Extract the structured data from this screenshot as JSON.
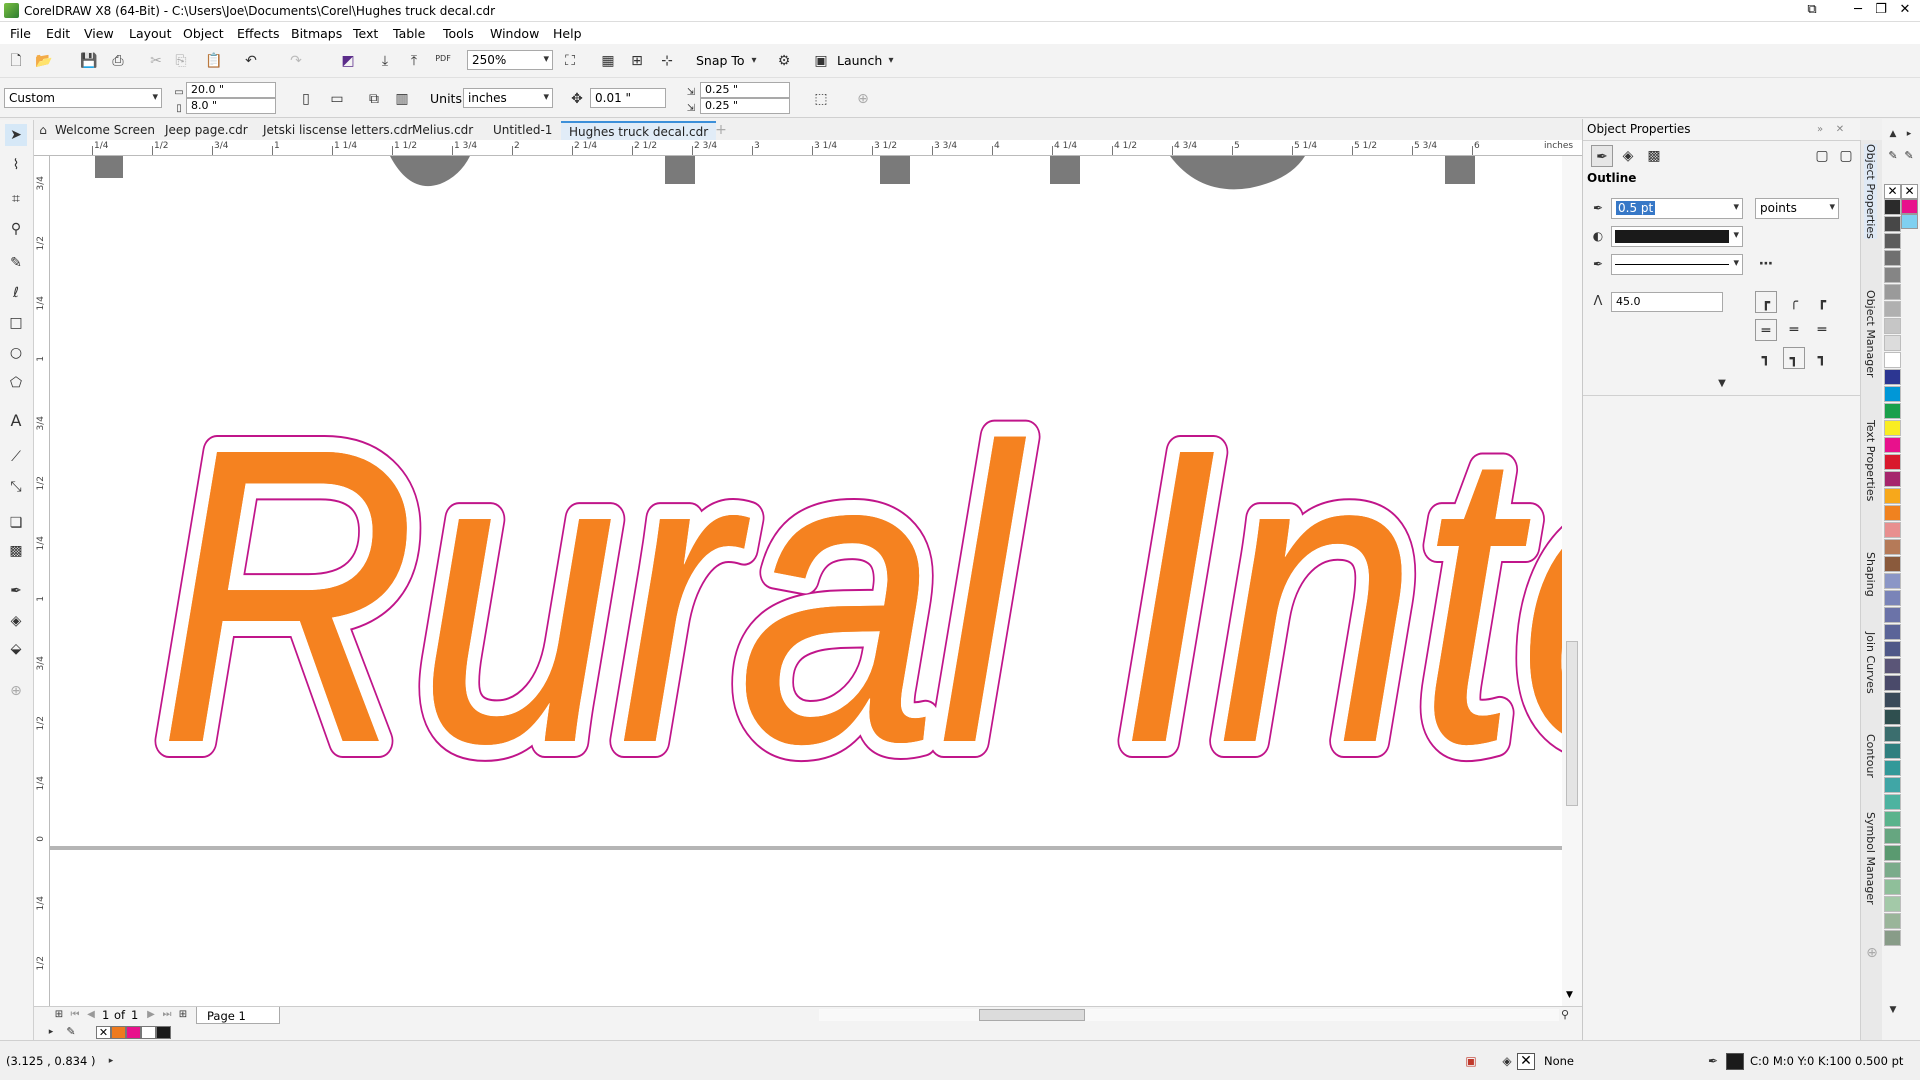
{
  "window": {
    "title": "CorelDRAW X8 (64-Bit) - C:\\Users\\Joe\\Documents\\Corel\\Hughes truck decal.cdr"
  },
  "menu": [
    "File",
    "Edit",
    "View",
    "Layout",
    "Object",
    "Effects",
    "Bitmaps",
    "Text",
    "Table",
    "Tools",
    "Window",
    "Help"
  ],
  "toolbar": {
    "pdf_label": "PDF",
    "zoom": "250%",
    "snap_label": "Snap To",
    "launch_label": "Launch"
  },
  "propertybar": {
    "page_size": "Custom",
    "width": "20.0 \"",
    "height": "8.0 \"",
    "units_label": "Units:",
    "units": "inches",
    "nudge": "0.01 \"",
    "dup_x": "0.25 \"",
    "dup_y": "0.25 \""
  },
  "tabs": [
    "Welcome Screen",
    "Jeep page.cdr",
    "Jetski liscense letters.cdr",
    "Melius.cdr",
    "Untitled-1",
    "Hughes truck decal.cdr"
  ],
  "active_tab": "Hughes truck decal.cdr",
  "ruler": {
    "h_labels": [
      "1/4",
      "1/2",
      "3/4",
      "1",
      "1 1/4",
      "1 1/2",
      "1 3/4",
      "2",
      "2 1/4",
      "2 1/2",
      "2 3/4",
      "3",
      "3 1/4",
      "3 1/2",
      "3 3/4",
      "4",
      "4 1/4",
      "4 1/2",
      "4 3/4",
      "5",
      "5 1/4",
      "5 1/2",
      "5 3/4",
      "6"
    ],
    "h_unit": "inches",
    "v_labels": [
      "3/4",
      "1/2",
      "1/4",
      "1",
      "3/4",
      "1/2",
      "1/4",
      "1",
      "3/4",
      "1/2",
      "1/4",
      "0",
      "1/4",
      "1/2"
    ]
  },
  "canvas_text": "Rural Inte",
  "page_nav": {
    "current": "1",
    "of_label": "of",
    "total": "1",
    "page_tab": "Page 1"
  },
  "docker": {
    "title": "Object Properties",
    "section": "Outline",
    "width_value": "0.5 pt",
    "width_units": "points",
    "color": "#1a1a1a",
    "miter": "45.0"
  },
  "docker_tabs": [
    "Object Properties",
    "Object Manager",
    "Text Properties",
    "Shaping",
    "Join Curves",
    "Contour",
    "Symbol Manager"
  ],
  "palette": [
    "#2b2b2b",
    "#474747",
    "#5c5c5c",
    "#707070",
    "#858585",
    "#9a9a9a",
    "#b0b0b0",
    "#c6c6c6",
    "#dcdcdc",
    "#ffffff",
    "#2c3692",
    "#0097d7",
    "#1aa04b",
    "#f9ed22",
    "#e8118c",
    "#d9182d",
    "#a6266d",
    "#f7a81b",
    "#f0821f",
    "#e88f8f",
    "#b57a58",
    "#8a5a3c",
    "#8b96c6",
    "#7a84b8",
    "#6b73a8",
    "#5b6498",
    "#4f5888",
    "#5a5577",
    "#4a4a6a",
    "#3a4a5a",
    "#2f4f4f",
    "#3b6e6e",
    "#2f7f7f",
    "#339999",
    "#40a6a6",
    "#4db3a0",
    "#5ab38c",
    "#66a680",
    "#5a9a70",
    "#7aab8a",
    "#8fbf9a",
    "#a3c9a8",
    "#9ab59a",
    "#889c88"
  ],
  "doc_palette": [
    "#ee7a1f",
    "#e8118c",
    "#ffffff",
    "#1a1a1a"
  ],
  "status": {
    "coords": "(3.125 , 0.834 )",
    "fill": "None",
    "outline": "C:0 M:0 Y:0 K:100  0.500 pt"
  },
  "colors": {
    "letter_fill": "#f58220",
    "outline": "#c0158a",
    "gray_text": "#7a7a7a"
  }
}
